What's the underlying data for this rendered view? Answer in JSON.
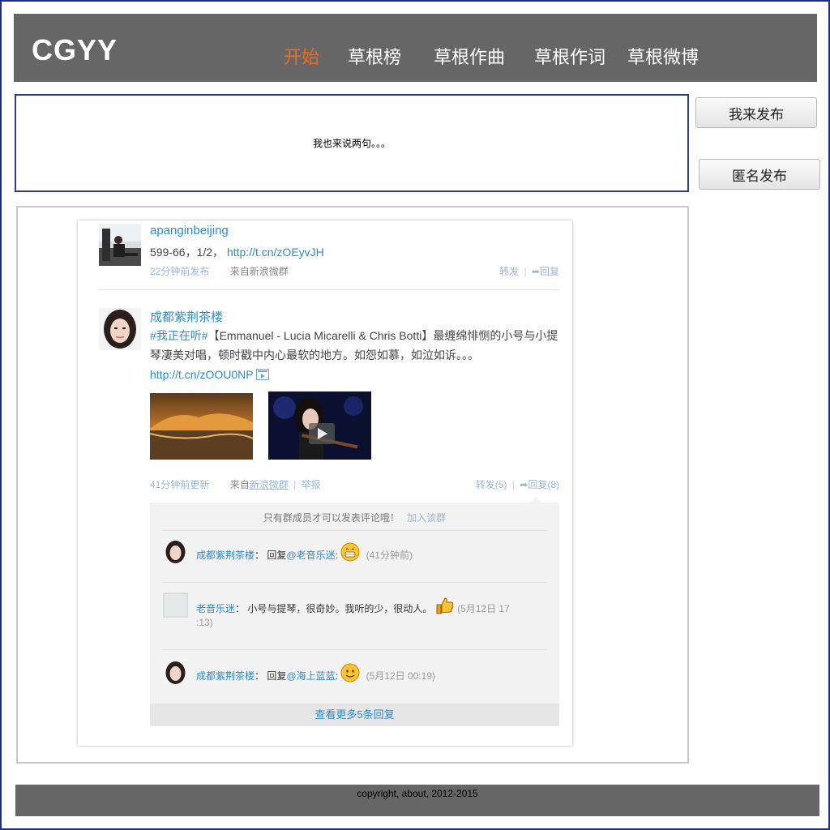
{
  "header": {
    "logo": "CGYY",
    "nav": [
      "开始",
      "草根榜",
      "草根作曲",
      "草根作词",
      "草根微博"
    ]
  },
  "compose": {
    "prompt": "我也来说两句。。。",
    "publish_button": "我来发布",
    "anon_button": "匿名发布"
  },
  "feed": {
    "post1": {
      "user": "apanginbeijing",
      "text_prefix": "599-66，1/2，",
      "link": "http://t.cn/zOEyvJH",
      "time": "22分钟前发布",
      "source_prefix": "来自",
      "source": "新浪微群",
      "repost": "转发",
      "reply": "回复"
    },
    "post2": {
      "user": "成都紫荆茶楼",
      "topic": "#我正在听#",
      "text": "【Emmanuel - Lucia Micarelli & Chris Botti】最缠绵悱恻的小号与小提琴凄美对唱，顿时戳中内心最软的地方。如怨如慕，如泣如诉。。。",
      "link_start": "http",
      "link_end": "://t.cn/zOOU0NP",
      "time": "41分钟前更新",
      "source_prefix": "来自",
      "source": "新浪微群",
      "report": "举报",
      "repost": "转发(5)",
      "reply": "回复(8)"
    },
    "comments": {
      "notice": "只有群成员才可以发表评论哦！",
      "join": "加入该群",
      "items": [
        {
          "user": "成都紫荆茶楼",
          "sep": "：",
          "text": "回复",
          "mention": "@老音乐迷",
          "colon": ":",
          "time": "(41分钟前)"
        },
        {
          "user": "老音乐迷",
          "sep": "：",
          "text": "小号与提琴，很奇妙。我听的少，很动人。",
          "time_a": "(5月12日 17",
          "time_b": ":13)"
        },
        {
          "user": "成都紫荆茶楼",
          "sep": "：",
          "text": "回复",
          "mention": "@海上蓝蓝",
          "colon": ":",
          "time": "(5月12日 00:19)"
        }
      ],
      "more": "查看更多5条回复"
    }
  },
  "footer": {
    "text": "copyright, about, 2012-2015"
  },
  "colors": {
    "header_bg": "#666666",
    "nav_active": "#f26b1d",
    "link": "#2d8bc9",
    "border": "#1c2f7a"
  }
}
